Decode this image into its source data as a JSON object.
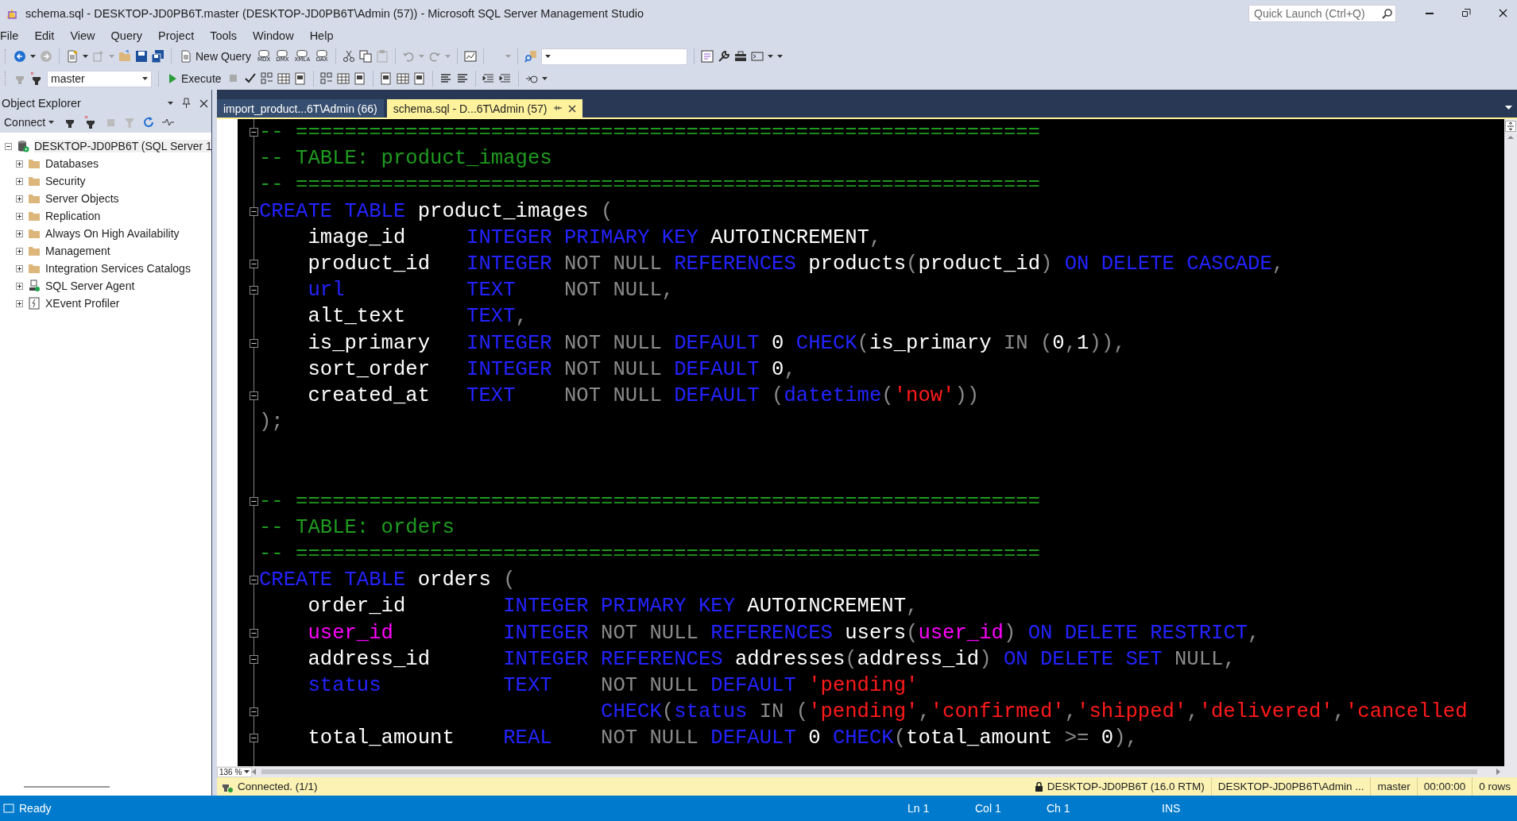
{
  "window": {
    "title": "schema.sql - DESKTOP-JD0PB6T.master (DESKTOP-JD0PB6T\\Admin (57)) - Microsoft SQL Server Management Studio",
    "quick_launch": {
      "placeholder": "Quick Launch (Ctrl+Q)"
    }
  },
  "menu": [
    "File",
    "Edit",
    "View",
    "Query",
    "Project",
    "Tools",
    "Window",
    "Help"
  ],
  "toolbar": {
    "new_query": "New Query",
    "query_types": [
      "MDX",
      "DMX",
      "XMLA",
      "DAX"
    ]
  },
  "query_toolbar": {
    "database": "master",
    "execute": "Execute"
  },
  "object_explorer": {
    "title": "Object Explorer",
    "connect": "Connect",
    "tree": {
      "label": "DESKTOP-JD0PB6T (SQL Server 1",
      "kind": "server",
      "expanded": true,
      "selected": true,
      "children": [
        {
          "label": "Databases",
          "kind": "folder",
          "expanded": false,
          "selected": false
        },
        {
          "label": "Security",
          "kind": "folder",
          "expanded": false,
          "selected": false
        },
        {
          "label": "Server Objects",
          "kind": "folder",
          "expanded": false,
          "selected": false
        },
        {
          "label": "Replication",
          "kind": "folder",
          "expanded": false,
          "selected": false
        },
        {
          "label": "Always On High Availability",
          "kind": "folder",
          "expanded": false,
          "selected": false
        },
        {
          "label": "Management",
          "kind": "folder",
          "expanded": false,
          "selected": false
        },
        {
          "label": "Integration Services Catalogs",
          "kind": "folder",
          "expanded": false,
          "selected": false
        },
        {
          "label": "SQL Server Agent",
          "kind": "agent",
          "expanded": false,
          "selected": false
        },
        {
          "label": "XEvent Profiler",
          "kind": "profiler",
          "expanded": false,
          "selected": false
        }
      ]
    }
  },
  "tabs": [
    {
      "label": "import_product...6T\\Admin (66)",
      "selected": false
    },
    {
      "label": "schema.sql - D...6T\\Admin (57)",
      "selected": true
    }
  ],
  "editor": {
    "zoom": "136 %",
    "lines": [
      {
        "kind": "code",
        "fold": true,
        "tokens": [
          {
            "kind": "comment",
            "text": "-- ============================================================="
          }
        ]
      },
      {
        "kind": "code",
        "fold": false,
        "tokens": [
          {
            "kind": "comment",
            "text": "-- TABLE: product_images"
          }
        ]
      },
      {
        "kind": "code",
        "fold": false,
        "tokens": [
          {
            "kind": "comment",
            "text": "-- ============================================================="
          }
        ]
      },
      {
        "kind": "code",
        "fold": true,
        "tokens": [
          {
            "kind": "keyword",
            "text": "CREATE TABLE"
          },
          {
            "kind": "plain",
            "text": " product_images "
          },
          {
            "kind": "operator",
            "text": "("
          }
        ]
      },
      {
        "kind": "code",
        "fold": false,
        "tokens": [
          {
            "kind": "plain",
            "text": "    image_id     "
          },
          {
            "kind": "keyword",
            "text": "INTEGER PRIMARY KEY"
          },
          {
            "kind": "plain",
            "text": " AUTOINCREMENT"
          },
          {
            "kind": "operator",
            "text": ","
          }
        ]
      },
      {
        "kind": "code",
        "fold": true,
        "tokens": [
          {
            "kind": "plain",
            "text": "    product_id   "
          },
          {
            "kind": "keyword",
            "text": "INTEGER"
          },
          {
            "kind": "operator",
            "text": " NOT NULL "
          },
          {
            "kind": "keyword",
            "text": "REFERENCES"
          },
          {
            "kind": "plain",
            "text": " products"
          },
          {
            "kind": "operator",
            "text": "("
          },
          {
            "kind": "plain",
            "text": "product_id"
          },
          {
            "kind": "operator",
            "text": ")"
          },
          {
            "kind": "keyword",
            "text": " ON DELETE CASCADE"
          },
          {
            "kind": "operator",
            "text": ","
          }
        ]
      },
      {
        "kind": "code",
        "fold": true,
        "tokens": [
          {
            "kind": "keyword",
            "text": "    url          "
          },
          {
            "kind": "keyword",
            "text": "TEXT"
          },
          {
            "kind": "operator",
            "text": "    NOT NULL,"
          }
        ]
      },
      {
        "kind": "code",
        "fold": false,
        "tokens": [
          {
            "kind": "plain",
            "text": "    alt_text     "
          },
          {
            "kind": "keyword",
            "text": "TEXT"
          },
          {
            "kind": "operator",
            "text": ","
          }
        ]
      },
      {
        "kind": "code",
        "fold": true,
        "tokens": [
          {
            "kind": "plain",
            "text": "    is_primary   "
          },
          {
            "kind": "keyword",
            "text": "INTEGER"
          },
          {
            "kind": "operator",
            "text": " NOT NULL "
          },
          {
            "kind": "keyword",
            "text": "DEFAULT"
          },
          {
            "kind": "plain",
            "text": " 0 "
          },
          {
            "kind": "keyword",
            "text": "CHECK"
          },
          {
            "kind": "operator",
            "text": "("
          },
          {
            "kind": "plain",
            "text": "is_primary"
          },
          {
            "kind": "operator",
            "text": " IN ("
          },
          {
            "kind": "plain",
            "text": "0"
          },
          {
            "kind": "operator",
            "text": ","
          },
          {
            "kind": "plain",
            "text": "1"
          },
          {
            "kind": "operator",
            "text": ")),"
          }
        ]
      },
      {
        "kind": "code",
        "fold": false,
        "tokens": [
          {
            "kind": "plain",
            "text": "    sort_order   "
          },
          {
            "kind": "keyword",
            "text": "INTEGER"
          },
          {
            "kind": "operator",
            "text": " NOT NULL "
          },
          {
            "kind": "keyword",
            "text": "DEFAULT"
          },
          {
            "kind": "plain",
            "text": " 0"
          },
          {
            "kind": "operator",
            "text": ","
          }
        ]
      },
      {
        "kind": "code",
        "fold": true,
        "tokens": [
          {
            "kind": "plain",
            "text": "    created_at   "
          },
          {
            "kind": "keyword",
            "text": "TEXT"
          },
          {
            "kind": "operator",
            "text": "    NOT NULL "
          },
          {
            "kind": "keyword",
            "text": "DEFAULT"
          },
          {
            "kind": "operator",
            "text": " ("
          },
          {
            "kind": "keyword",
            "text": "datetime"
          },
          {
            "kind": "operator",
            "text": "("
          },
          {
            "kind": "string",
            "text": "'now'"
          },
          {
            "kind": "operator",
            "text": "))"
          }
        ]
      },
      {
        "kind": "code",
        "fold": false,
        "tokens": [
          {
            "kind": "operator",
            "text": ");"
          }
        ]
      },
      {
        "kind": "blank"
      },
      {
        "kind": "blank"
      },
      {
        "kind": "code",
        "fold": true,
        "tokens": [
          {
            "kind": "comment",
            "text": "-- ============================================================="
          }
        ]
      },
      {
        "kind": "code",
        "fold": false,
        "tokens": [
          {
            "kind": "comment",
            "text": "-- TABLE: orders"
          }
        ]
      },
      {
        "kind": "code",
        "fold": false,
        "tokens": [
          {
            "kind": "comment",
            "text": "-- ============================================================="
          }
        ]
      },
      {
        "kind": "code",
        "fold": true,
        "tokens": [
          {
            "kind": "keyword",
            "text": "CREATE TABLE"
          },
          {
            "kind": "plain",
            "text": " orders "
          },
          {
            "kind": "operator",
            "text": "("
          }
        ]
      },
      {
        "kind": "code",
        "fold": false,
        "tokens": [
          {
            "kind": "plain",
            "text": "    order_id        "
          },
          {
            "kind": "keyword",
            "text": "INTEGER PRIMARY KEY"
          },
          {
            "kind": "plain",
            "text": " AUTOINCREMENT"
          },
          {
            "kind": "operator",
            "text": ","
          }
        ]
      },
      {
        "kind": "code",
        "fold": true,
        "tokens": [
          {
            "kind": "variable",
            "text": "    user_id         "
          },
          {
            "kind": "keyword",
            "text": "INTEGER"
          },
          {
            "kind": "operator",
            "text": " NOT NULL "
          },
          {
            "kind": "keyword",
            "text": "REFERENCES"
          },
          {
            "kind": "plain",
            "text": " users"
          },
          {
            "kind": "operator",
            "text": "("
          },
          {
            "kind": "variable",
            "text": "user_id"
          },
          {
            "kind": "operator",
            "text": ")"
          },
          {
            "kind": "keyword",
            "text": " ON DELETE RESTRICT"
          },
          {
            "kind": "operator",
            "text": ","
          }
        ]
      },
      {
        "kind": "code",
        "fold": true,
        "tokens": [
          {
            "kind": "plain",
            "text": "    address_id      "
          },
          {
            "kind": "keyword",
            "text": "INTEGER REFERENCES"
          },
          {
            "kind": "plain",
            "text": " addresses"
          },
          {
            "kind": "operator",
            "text": "("
          },
          {
            "kind": "plain",
            "text": "address_id"
          },
          {
            "kind": "operator",
            "text": ")"
          },
          {
            "kind": "keyword",
            "text": " ON DELETE SET"
          },
          {
            "kind": "operator",
            "text": " NULL,"
          }
        ]
      },
      {
        "kind": "code",
        "fold": false,
        "tokens": [
          {
            "kind": "keyword",
            "text": "    status          "
          },
          {
            "kind": "keyword",
            "text": "TEXT"
          },
          {
            "kind": "operator",
            "text": "    NOT NULL "
          },
          {
            "kind": "keyword",
            "text": "DEFAULT "
          },
          {
            "kind": "string",
            "text": "'pending'"
          }
        ]
      },
      {
        "kind": "code",
        "fold": true,
        "tokens": [
          {
            "kind": "keyword",
            "text": "                            CHECK"
          },
          {
            "kind": "operator",
            "text": "("
          },
          {
            "kind": "keyword",
            "text": "status"
          },
          {
            "kind": "operator",
            "text": " IN ("
          },
          {
            "kind": "string",
            "text": "'pending'"
          },
          {
            "kind": "operator",
            "text": ","
          },
          {
            "kind": "string",
            "text": "'confirmed'"
          },
          {
            "kind": "operator",
            "text": ","
          },
          {
            "kind": "string",
            "text": "'shipped'"
          },
          {
            "kind": "operator",
            "text": ","
          },
          {
            "kind": "string",
            "text": "'delivered'"
          },
          {
            "kind": "operator",
            "text": ","
          },
          {
            "kind": "string",
            "text": "'cancelled"
          }
        ]
      },
      {
        "kind": "code",
        "fold": true,
        "tokens": [
          {
            "kind": "plain",
            "text": "    total_amount    "
          },
          {
            "kind": "keyword",
            "text": "REAL"
          },
          {
            "kind": "operator",
            "text": "    NOT NULL "
          },
          {
            "kind": "keyword",
            "text": "DEFAULT"
          },
          {
            "kind": "plain",
            "text": " 0 "
          },
          {
            "kind": "keyword",
            "text": "CHECK"
          },
          {
            "kind": "operator",
            "text": "("
          },
          {
            "kind": "plain",
            "text": "total_amount"
          },
          {
            "kind": "operator",
            "text": " >= "
          },
          {
            "kind": "plain",
            "text": "0"
          },
          {
            "kind": "operator",
            "text": "),"
          }
        ]
      }
    ]
  },
  "query_status": {
    "message": "Connected. (1/1)",
    "server": "DESKTOP-JD0PB6T (16.0 RTM)",
    "user": "DESKTOP-JD0PB6T\\Admin ...",
    "database": "master",
    "elapsed": "00:00:00",
    "rows": "0 rows"
  },
  "status_bar": {
    "state": "Ready",
    "line": "Ln 1",
    "column": "Col 1",
    "character": "Ch 1",
    "mode": "INS"
  }
}
